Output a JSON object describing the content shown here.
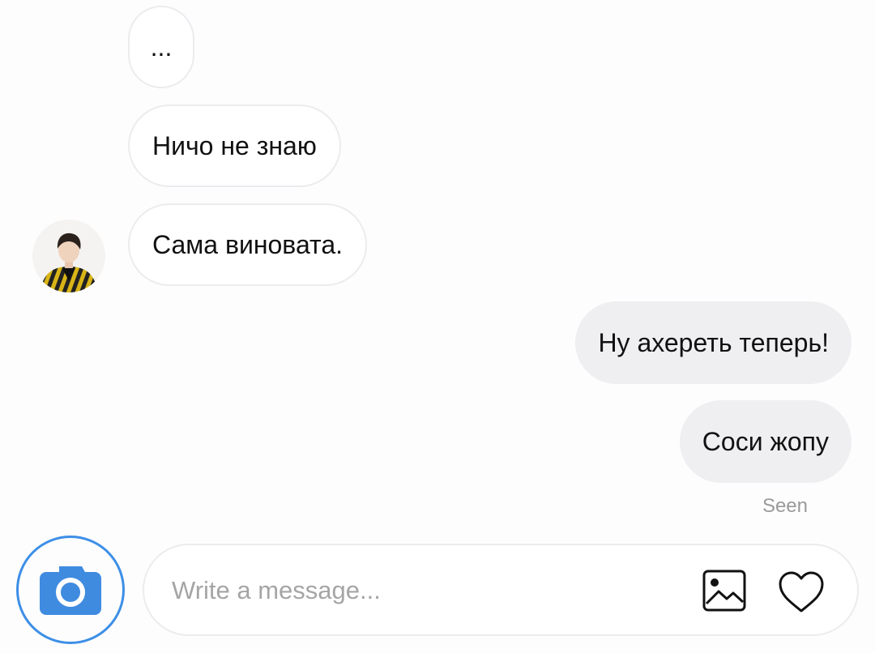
{
  "messages": {
    "incoming": [
      "...",
      "Ничо не знаю",
      "Сама виновата."
    ],
    "outgoing": [
      "Ну ахереть теперь!",
      "Соси жопу"
    ]
  },
  "status": {
    "seen": "Seen"
  },
  "composer": {
    "placeholder": "Write a message...",
    "value": "",
    "icons": [
      "camera-icon",
      "gallery-icon",
      "heart-icon"
    ]
  },
  "colors": {
    "accent": "#3d8fe6",
    "camera_fill": "#3f8be0",
    "incoming_bubble": "#ffffff",
    "incoming_border": "#ececef",
    "outgoing_bubble": "#efeff2"
  }
}
